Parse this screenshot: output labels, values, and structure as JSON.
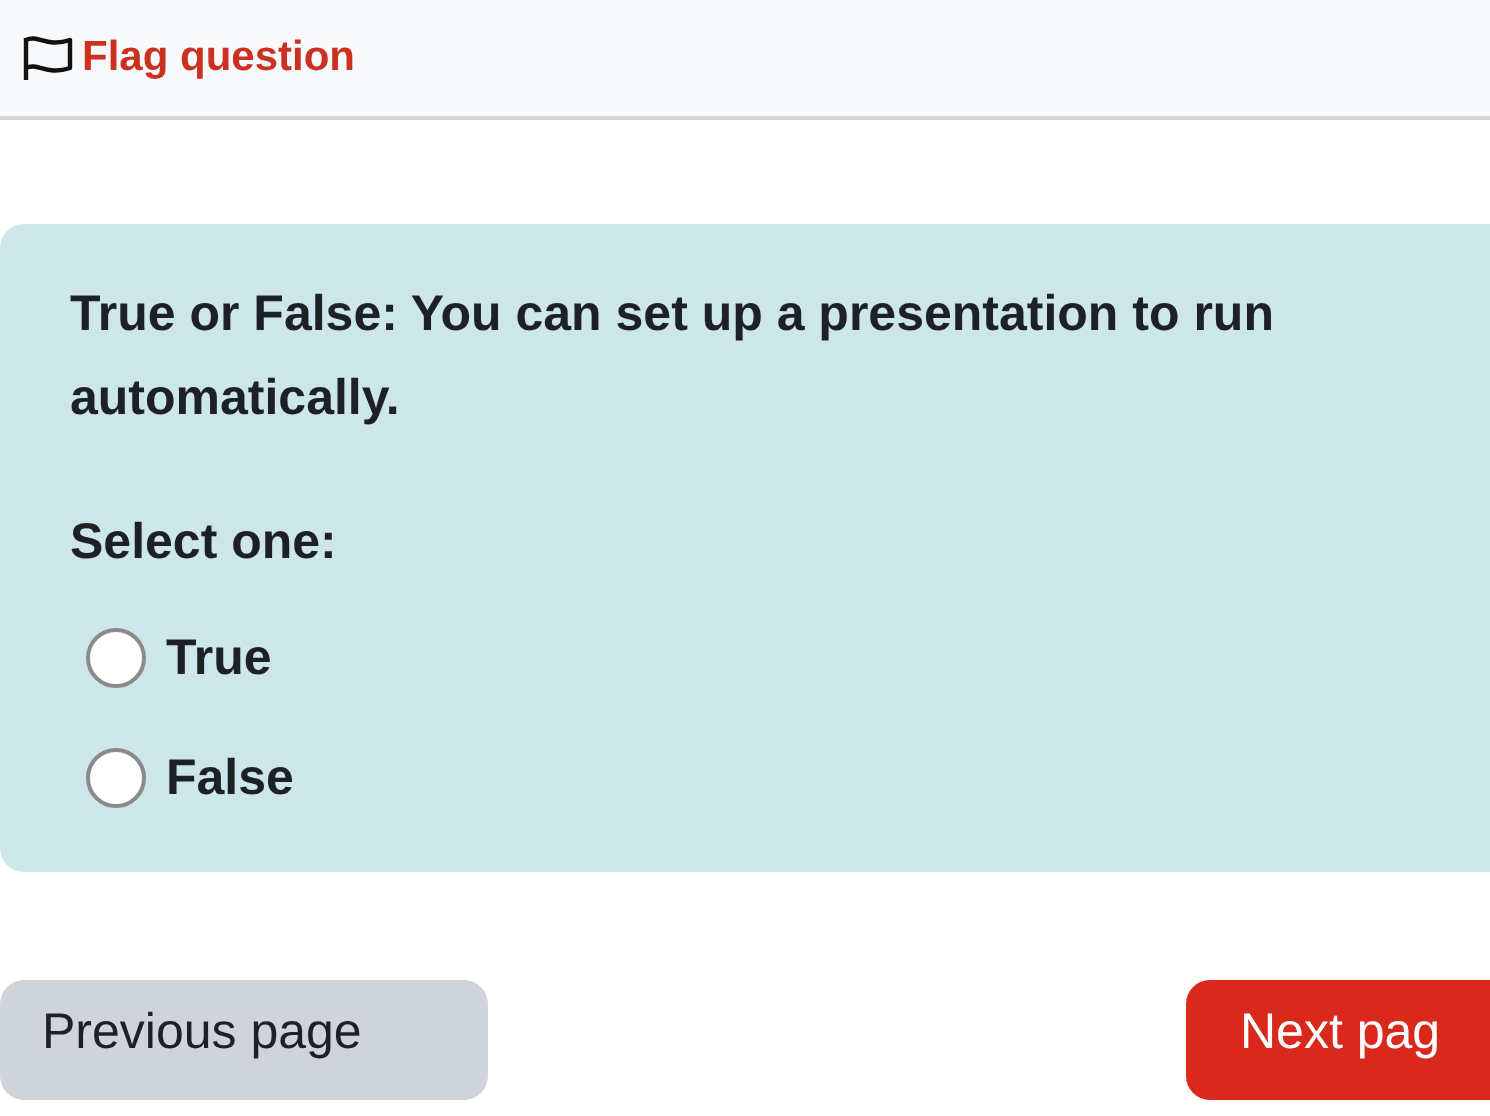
{
  "header": {
    "flag_label": "Flag question",
    "flagged": false
  },
  "question": {
    "text": "True or False: You can set up a presentation to run automatically.",
    "prompt": "Select one:",
    "options": [
      {
        "label": "True",
        "selected": false
      },
      {
        "label": "False",
        "selected": false
      }
    ]
  },
  "navigation": {
    "previous": "Previous page",
    "next": "Next pag"
  }
}
